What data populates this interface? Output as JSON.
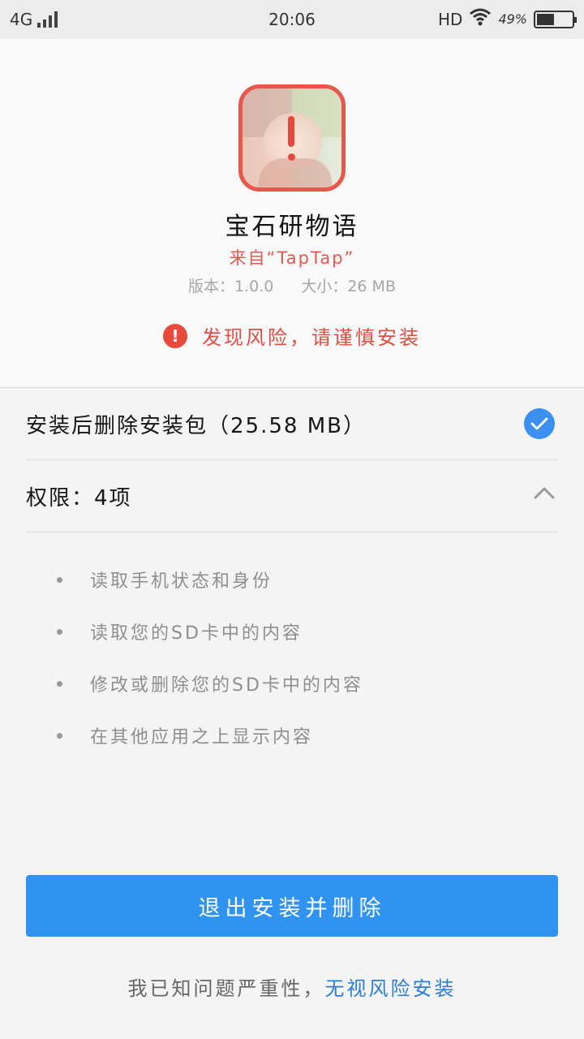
{
  "status_bar": {
    "network": "4G",
    "time": "20:06",
    "hd": "HD",
    "battery_percent": "49%",
    "battery_level": 0.49
  },
  "app": {
    "name": "宝石研物语",
    "source": "来自“TapTap”",
    "version": "版本：1.0.0",
    "size": "大小：26 MB"
  },
  "risk": {
    "icon": "!",
    "message": "发现风险，请谨慎安装"
  },
  "options": {
    "delete_after_install": "安装后删除安装包（25.58 MB）",
    "delete_checked": true,
    "permissions_label": "权限：4项"
  },
  "permissions": [
    "读取手机状态和身份",
    "读取您的SD卡中的内容",
    "修改或删除您的SD卡中的内容",
    "在其他应用之上显示内容"
  ],
  "buttons": {
    "exit_delete": "退出安装并删除",
    "footer_text": "我已知问题严重性，",
    "footer_link": "无视风险安装"
  },
  "colors": {
    "accent_blue": "#2f93ef",
    "risk_red": "#e84a3d"
  }
}
